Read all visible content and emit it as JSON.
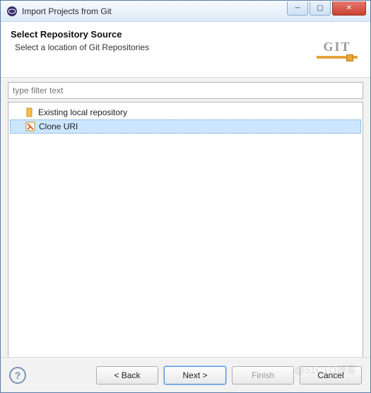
{
  "window": {
    "title": "Import Projects from Git"
  },
  "header": {
    "title": "Select Repository Source",
    "subtitle": "Select a location of Git Repositories",
    "logo_text": "GIT"
  },
  "filter": {
    "placeholder": "type filter text",
    "value": ""
  },
  "tree": {
    "items": [
      {
        "label": "Existing local repository",
        "icon": "repo-icon",
        "selected": false
      },
      {
        "label": "Clone URI",
        "icon": "clone-icon",
        "selected": true
      }
    ]
  },
  "buttons": {
    "back": "< Back",
    "next": "Next >",
    "finish": "Finish",
    "cancel": "Cancel"
  },
  "watermark": "@51CTO博客"
}
